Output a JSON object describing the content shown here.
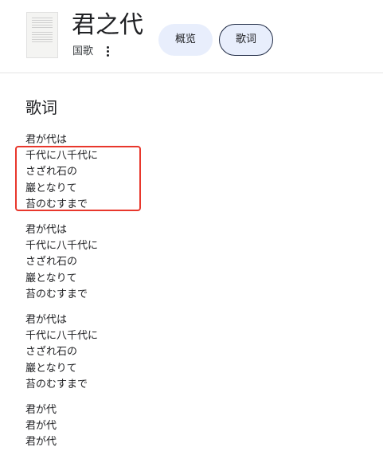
{
  "header": {
    "title": "君之代",
    "subtitle": "国歌",
    "tabs": [
      {
        "label": "概览"
      },
      {
        "label": "歌词"
      }
    ]
  },
  "lyrics_section": {
    "title": "歌词",
    "stanzas": [
      [
        "君が代は",
        "千代に八千代に",
        "さざれ石の",
        "巖となりて",
        "苔のむすまで"
      ],
      [
        "君が代は",
        "千代に八千代に",
        "さざれ石の",
        "巖となりて",
        "苔のむすまで"
      ],
      [
        "君が代は",
        "千代に八千代に",
        "さざれ石の",
        "巖となりて",
        "苔のむすまで"
      ],
      [
        "君が代",
        "君が代",
        "君が代"
      ]
    ]
  },
  "colors": {
    "tab_background": "#e8eefc",
    "selected_tab_border": "#1f2a44",
    "highlight": "#e8372c",
    "divider": "#e3e3e3"
  },
  "icons": {
    "more": "kebab-menu-icon",
    "thumbnail": "sheet-music-thumbnail"
  }
}
